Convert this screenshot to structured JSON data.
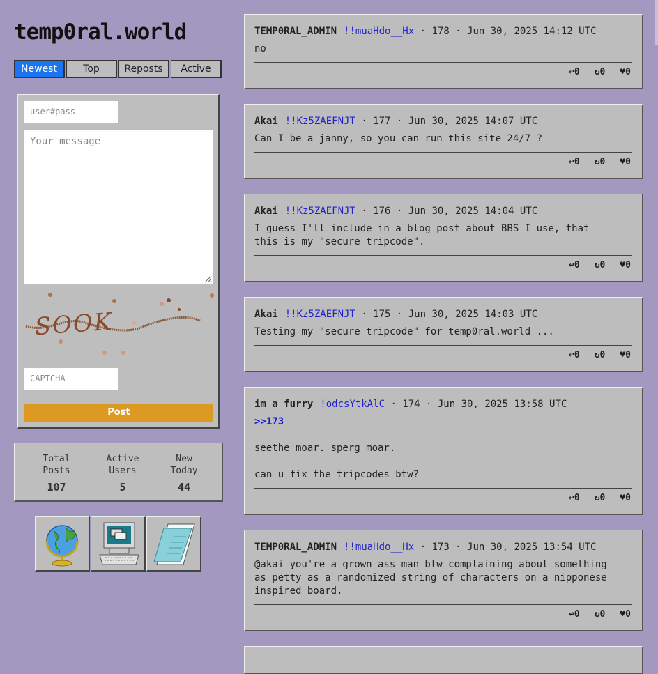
{
  "site": {
    "logo": "temp0ral.world"
  },
  "tabs": [
    {
      "label": "Newest"
    },
    {
      "label": "Top"
    },
    {
      "label": "Reposts"
    },
    {
      "label": "Active"
    }
  ],
  "form": {
    "user_placeholder": "user#pass",
    "message_placeholder": "Your message",
    "captcha_placeholder": "CAPTCHA",
    "captcha_text": "SOOK",
    "post_label": "Post"
  },
  "stats": [
    {
      "label_line1": "Total",
      "label_line2": "Posts",
      "value": "107"
    },
    {
      "label_line1": "Active",
      "label_line2": "Users",
      "value": "5"
    },
    {
      "label_line1": "New",
      "label_line2": "Today",
      "value": "44"
    }
  ],
  "icons": [
    "globe-icon",
    "computer-icon",
    "notepad-icon"
  ],
  "posts": [
    {
      "author": "TEMP0RAL_ADMIN",
      "trip": "!!muaHdo__Hx",
      "meta": "· 178 · Jun 30, 2025 14:12 UTC",
      "body": "no",
      "reply": "↩0",
      "repost": "↻0",
      "like": "♥0"
    },
    {
      "author": "Akai",
      "trip": "!!Kz5ZAEFNJT",
      "meta": "· 177 · Jun 30, 2025 14:07 UTC",
      "body": "Can I be a janny, so you can run this site 24/7 ?",
      "reply": "↩0",
      "repost": "↻0",
      "like": "♥0"
    },
    {
      "author": "Akai",
      "trip": "!!Kz5ZAEFNJT",
      "meta": "· 176 · Jun 30, 2025 14:04 UTC",
      "body": "I guess I'll include in a blog post about BBS I use, that\nthis is my \"secure tripcode\".",
      "reply": "↩0",
      "repost": "↻0",
      "like": "♥0"
    },
    {
      "author": "Akai",
      "trip": "!!Kz5ZAEFNJT",
      "meta": "· 175 · Jun 30, 2025 14:03 UTC",
      "body": "Testing my \"secure tripcode\" for temp0ral.world ...",
      "reply": "↩0",
      "repost": "↻0",
      "like": "♥0"
    },
    {
      "author": "im a furry",
      "trip": "!odcsYtkAlC",
      "meta": "· 174 · Jun 30, 2025 13:58 UTC",
      "reply_link": ">>173",
      "body": "seethe moar. sperg moar.\n\ncan u fix the tripcodes btw?",
      "reply": "↩0",
      "repost": "↻0",
      "like": "♥0"
    },
    {
      "author": "TEMP0RAL_ADMIN",
      "trip": "!!muaHdo__Hx",
      "meta": "· 173 · Jun 30, 2025 13:54 UTC",
      "body": "@akai you're a grown ass man btw complaining about something\nas petty as a randomized string of characters on a nipponese\ninspired board.",
      "reply": "↩0",
      "repost": "↻0",
      "like": "♥0"
    }
  ]
}
